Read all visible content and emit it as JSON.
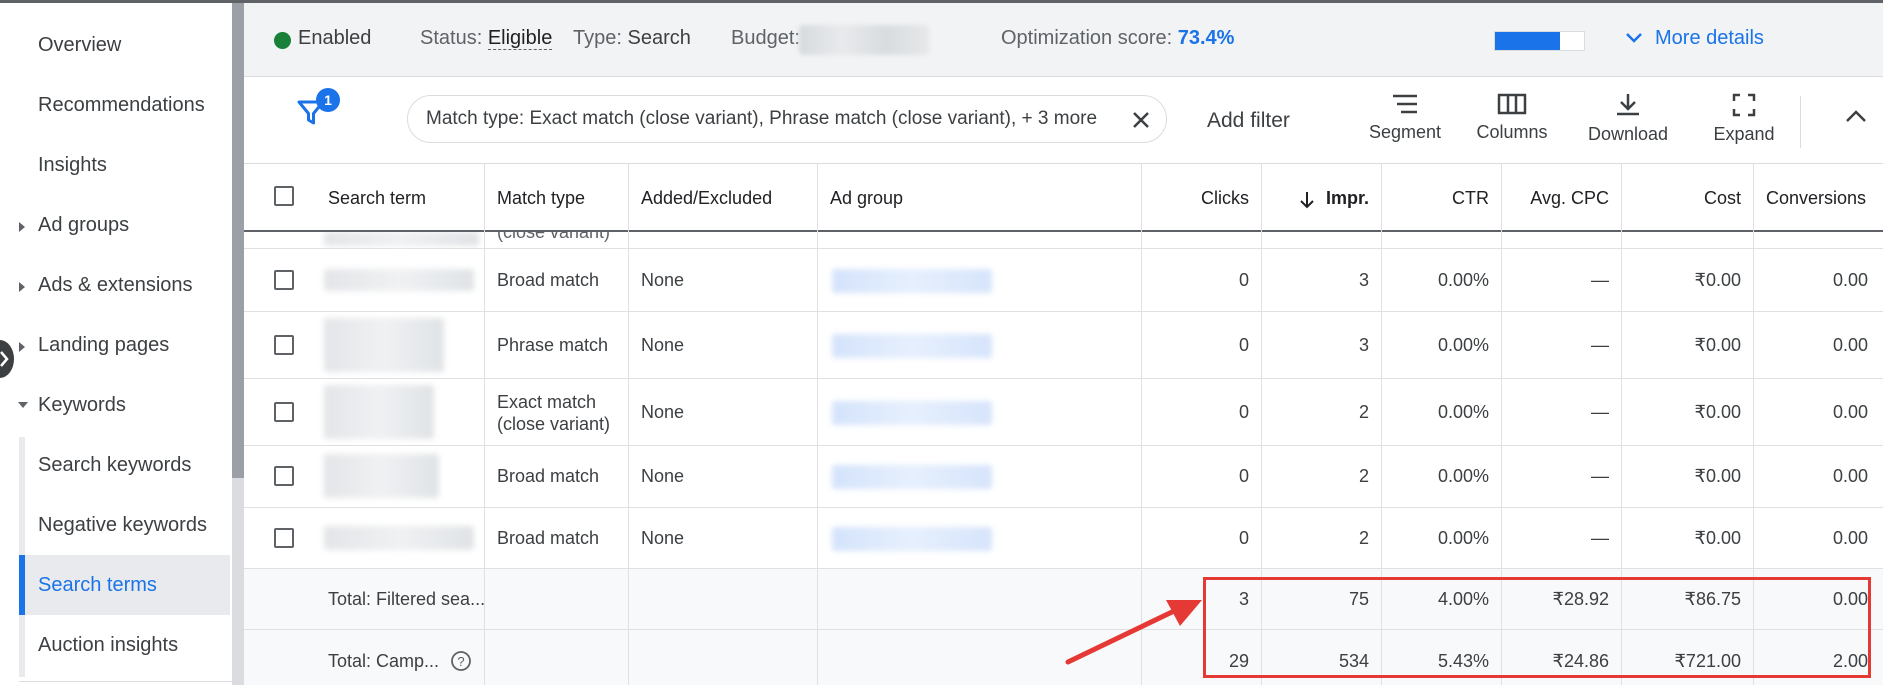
{
  "sidebar": {
    "items": [
      {
        "label": "Overview"
      },
      {
        "label": "Recommendations"
      },
      {
        "label": "Insights"
      },
      {
        "label": "Ad groups"
      },
      {
        "label": "Ads & extensions"
      },
      {
        "label": "Landing pages"
      },
      {
        "label": "Keywords"
      },
      {
        "label": "Search keywords"
      },
      {
        "label": "Negative keywords"
      },
      {
        "label": "Search terms"
      },
      {
        "label": "Auction insights"
      }
    ]
  },
  "header": {
    "status_enabled": "Enabled",
    "status_label": "Status:",
    "status_value": "Eligible",
    "type_label": "Type:",
    "type_value": "Search",
    "budget_label": "Budget:",
    "opt_label": "Optimization score:",
    "opt_value": "73.4%",
    "opt_fraction": 0.734,
    "more_details": "More details"
  },
  "toolbar": {
    "filter_count": "1",
    "chip_text": "Match type: Exact match (close variant), Phrase match (close variant), + 3 more",
    "add_filter": "Add filter",
    "segment": "Segment",
    "columns": "Columns",
    "download": "Download",
    "expand": "Expand"
  },
  "table": {
    "headers": {
      "search_term": "Search term",
      "match_type": "Match type",
      "added_excluded": "Added/Excluded",
      "ad_group": "Ad group",
      "clicks": "Clicks",
      "impr": "Impr.",
      "ctr": "CTR",
      "avg_cpc": "Avg. CPC",
      "cost": "Cost",
      "conversions": "Conversions"
    },
    "partial_row_match": "(close variant)",
    "rows": [
      {
        "match": "Broad match",
        "match2": "",
        "added": "None",
        "clicks": "0",
        "impr": "3",
        "ctr": "0.00%",
        "cpc": "—",
        "cost": "₹0.00",
        "conv": "0.00"
      },
      {
        "match": "Phrase match",
        "match2": "",
        "added": "None",
        "clicks": "0",
        "impr": "3",
        "ctr": "0.00%",
        "cpc": "—",
        "cost": "₹0.00",
        "conv": "0.00"
      },
      {
        "match": "Exact match",
        "match2": "(close variant)",
        "added": "None",
        "clicks": "0",
        "impr": "2",
        "ctr": "0.00%",
        "cpc": "—",
        "cost": "₹0.00",
        "conv": "0.00"
      },
      {
        "match": "Broad match",
        "match2": "",
        "added": "None",
        "clicks": "0",
        "impr": "2",
        "ctr": "0.00%",
        "cpc": "—",
        "cost": "₹0.00",
        "conv": "0.00"
      },
      {
        "match": "Broad match",
        "match2": "",
        "added": "None",
        "clicks": "0",
        "impr": "2",
        "ctr": "0.00%",
        "cpc": "—",
        "cost": "₹0.00",
        "conv": "0.00"
      }
    ],
    "totals": [
      {
        "label": "Total: Filtered sea...",
        "clicks": "3",
        "impr": "75",
        "ctr": "4.00%",
        "cpc": "₹28.92",
        "cost": "₹86.75",
        "conv": "0.00"
      },
      {
        "label": "Total: Camp...",
        "clicks": "29",
        "impr": "534",
        "ctr": "5.43%",
        "cpc": "₹24.86",
        "cost": "₹721.00",
        "conv": "2.00"
      }
    ]
  },
  "colors": {
    "accent": "#1a73e8",
    "enabled_dot": "#188038",
    "annotation": "#e53935"
  },
  "icons": [
    "filter-icon",
    "close-icon",
    "segment-icon",
    "columns-icon",
    "download-icon",
    "expand-icon",
    "chevron-up-icon",
    "chevron-down-icon",
    "sort-down-arrow-icon",
    "help-icon"
  ]
}
